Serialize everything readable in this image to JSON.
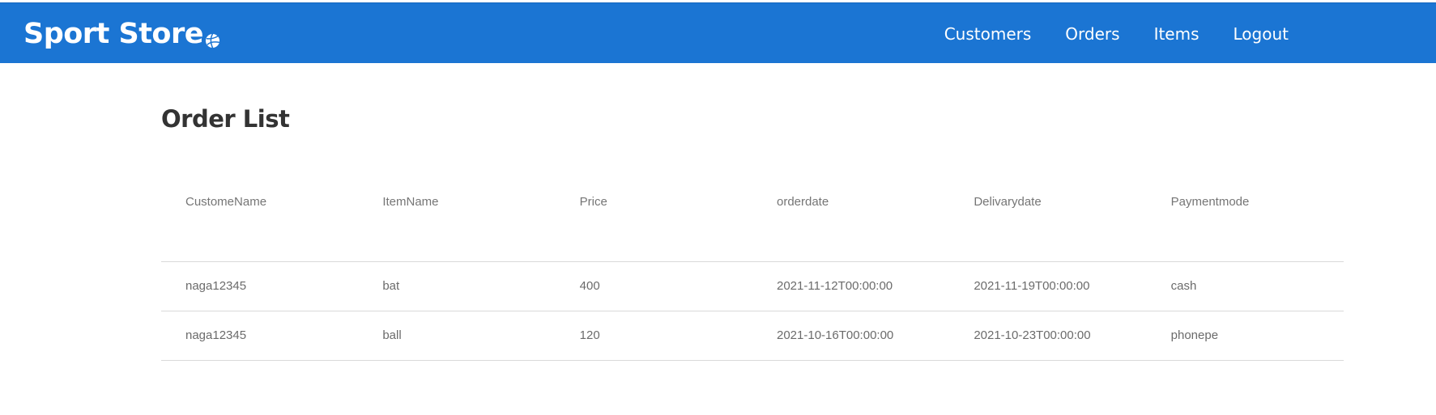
{
  "brand": {
    "name": "Sport Store",
    "icon": "volleyball-icon"
  },
  "nav": {
    "customers": "Customers",
    "orders": "Orders",
    "items": "Items",
    "logout": "Logout"
  },
  "page": {
    "title": "Order List"
  },
  "table": {
    "headers": [
      "CustomeName",
      "ItemName",
      "Price",
      "orderdate",
      "Delivarydate",
      "Paymentmode"
    ],
    "rows": [
      [
        "naga12345",
        "bat",
        "400",
        "2021-11-12T00:00:00",
        "2021-11-19T00:00:00",
        "cash"
      ],
      [
        "naga12345",
        "ball",
        "120",
        "2021-10-16T00:00:00",
        "2021-10-23T00:00:00",
        "phonepe"
      ]
    ]
  },
  "colors": {
    "navbar": "#1b75d3",
    "text": "#6b6b6b",
    "title": "#333333"
  }
}
